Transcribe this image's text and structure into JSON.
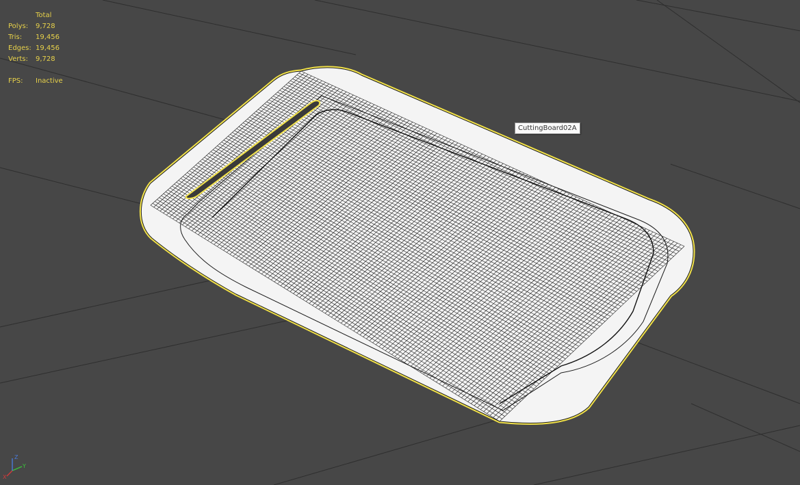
{
  "stats": {
    "header": "Total",
    "rows": [
      {
        "label": "Polys:",
        "value": "9,728"
      },
      {
        "label": "Tris:",
        "value": "19,456"
      },
      {
        "label": "Edges:",
        "value": "19,456"
      },
      {
        "label": "Verts:",
        "value": "9,728"
      }
    ],
    "fps_label": "FPS:",
    "fps_value": "Inactive"
  },
  "tooltip": {
    "object_name": "CuttingBoard02A"
  },
  "gizmo": {
    "x": "X",
    "y": "Y",
    "z": "Z"
  },
  "colors": {
    "background": "#474747",
    "grid": "#2e2e2e",
    "selection": "#f2e24a",
    "mesh_fill": "#f4f4f4",
    "wire": "#1a1a1a",
    "stats_text": "#e8d24a"
  }
}
